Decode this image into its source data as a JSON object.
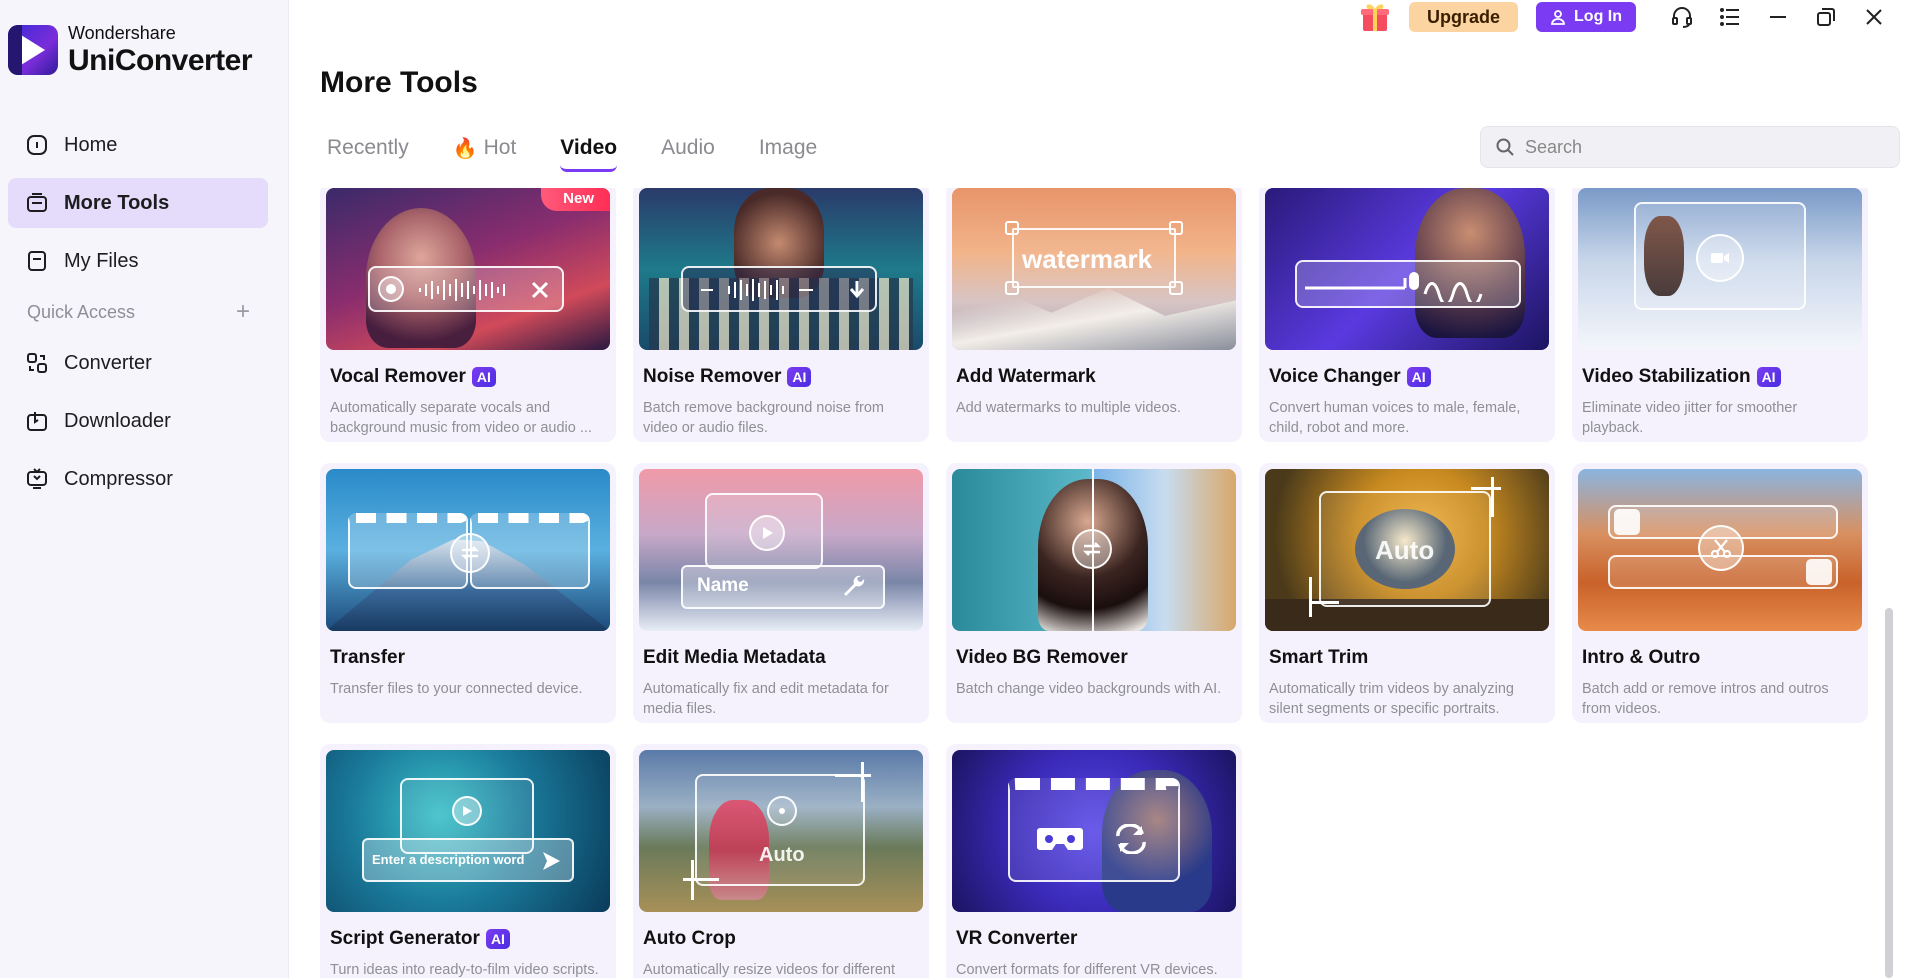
{
  "app": {
    "brand_top": "Wondershare",
    "brand_main": "UniConverter"
  },
  "topbar": {
    "upgrade_label": "Upgrade",
    "login_label": "Log In",
    "colors": {
      "upgrade_bg": "#fcd4a2",
      "login_bg": "#7a3bf2"
    }
  },
  "sidebar": {
    "items": [
      {
        "label": "Home",
        "icon": "home-icon"
      },
      {
        "label": "More Tools",
        "icon": "more-tools-icon",
        "active": true
      },
      {
        "label": "My Files",
        "icon": "my-files-icon"
      }
    ],
    "quick_access_label": "Quick Access",
    "quick_items": [
      {
        "label": "Converter",
        "icon": "converter-icon"
      },
      {
        "label": "Downloader",
        "icon": "downloader-icon"
      },
      {
        "label": "Compressor",
        "icon": "compressor-icon"
      }
    ]
  },
  "main": {
    "title": "More Tools",
    "tabs": [
      {
        "label": "Recently"
      },
      {
        "label": "Hot",
        "icon": "fire-icon"
      },
      {
        "label": "Video",
        "active": true
      },
      {
        "label": "Audio"
      },
      {
        "label": "Image"
      }
    ],
    "search": {
      "placeholder": "Search",
      "value": ""
    }
  },
  "cards": [
    {
      "title": "Vocal Remover",
      "ai": "AI",
      "badge": "New",
      "desc": "Automatically separate vocals and background music from video or audio ..."
    },
    {
      "title": "Noise Remover",
      "ai": "AI",
      "desc": "Batch remove background noise from video or audio files."
    },
    {
      "title": "Add Watermark",
      "overlay_text": "watermark",
      "desc": "Add watermarks to multiple videos."
    },
    {
      "title": "Voice Changer",
      "ai": "AI",
      "desc": "Convert human voices to male, female, child, robot and more."
    },
    {
      "title": "Video Stabilization",
      "ai": "AI",
      "desc": "Eliminate video jitter for smoother playback."
    },
    {
      "title": "Transfer",
      "desc": "Transfer files to your connected device."
    },
    {
      "title": "Edit Media Metadata",
      "overlay_text": "Name",
      "desc": "Automatically fix and edit metadata for media files."
    },
    {
      "title": "Video BG Remover",
      "desc": "Batch change video backgrounds with AI."
    },
    {
      "title": "Smart Trim",
      "overlay_text": "Auto",
      "desc": "Automatically trim videos by analyzing silent segments or specific portraits."
    },
    {
      "title": "Intro & Outro",
      "desc": "Batch add or remove intros and outros from videos."
    },
    {
      "title": "Script Generator",
      "ai": "AI",
      "overlay_text": "Enter a description word",
      "desc": "Turn ideas into ready-to-film video scripts."
    },
    {
      "title": "Auto Crop",
      "overlay_text": "Auto",
      "desc": "Automatically resize videos for different social platforms."
    },
    {
      "title": "VR Converter",
      "desc": "Convert formats for different VR devices."
    }
  ]
}
